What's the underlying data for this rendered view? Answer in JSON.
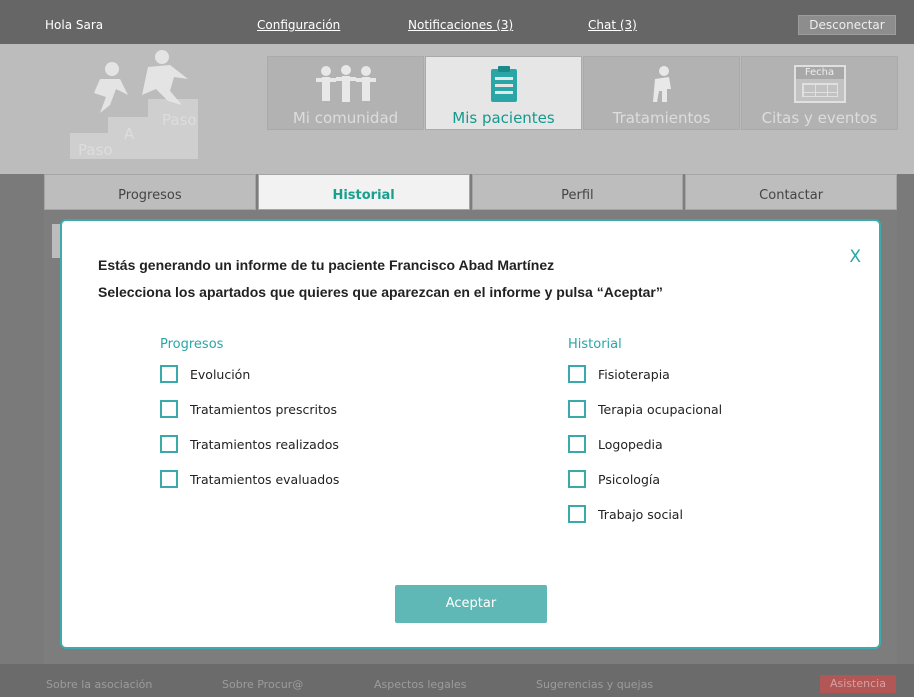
{
  "topbar": {
    "greeting": "Hola Sara",
    "links": [
      "Configuración",
      "Notificaciones (3)",
      "Chat (3)"
    ],
    "logout": "Desconectar"
  },
  "logo": {
    "words": [
      "Paso",
      "A",
      "Paso"
    ]
  },
  "mainnav": [
    {
      "label": "Mi comunidad",
      "icon": "community-icon",
      "active": false
    },
    {
      "label": "Mis pacientes",
      "icon": "clipboard-icon",
      "active": true
    },
    {
      "label": "Tratamientos",
      "icon": "person-icon",
      "active": false
    },
    {
      "label": "Citas y eventos",
      "icon": "calendar-icon",
      "active": false,
      "icon_text": "Fecha"
    }
  ],
  "tabs": [
    {
      "label": "Progresos",
      "active": false
    },
    {
      "label": "Historial",
      "active": true
    },
    {
      "label": "Perfil",
      "active": false
    },
    {
      "label": "Contactar",
      "active": false
    }
  ],
  "modal": {
    "close": "X",
    "line1": "Estás generando un informe de  tu paciente Francisco Abad Martínez",
    "line2": "Selecciona los apartados que quieres que aparezcan en el informe y pulsa “Aceptar”",
    "progresos": {
      "heading": "Progresos",
      "options": [
        "Evolución",
        "Tratamientos prescritos",
        "Tratamientos realizados",
        "Tratamientos evaluados"
      ]
    },
    "historial": {
      "heading": "Historial",
      "options": [
        "Fisioterapia",
        "Terapia ocupacional",
        "Logopedia",
        "Psicología",
        "Trabajo social"
      ]
    },
    "accept": "Aceptar"
  },
  "footer": {
    "links": [
      "Sobre la asociación",
      "Sobre Procur@",
      "Aspectos legales",
      "Sugerencias y quejas"
    ],
    "help": "Asistencia"
  },
  "colors": {
    "accent": "#2aa6a6",
    "button": "#5fb8b5",
    "help": "#b35656"
  }
}
